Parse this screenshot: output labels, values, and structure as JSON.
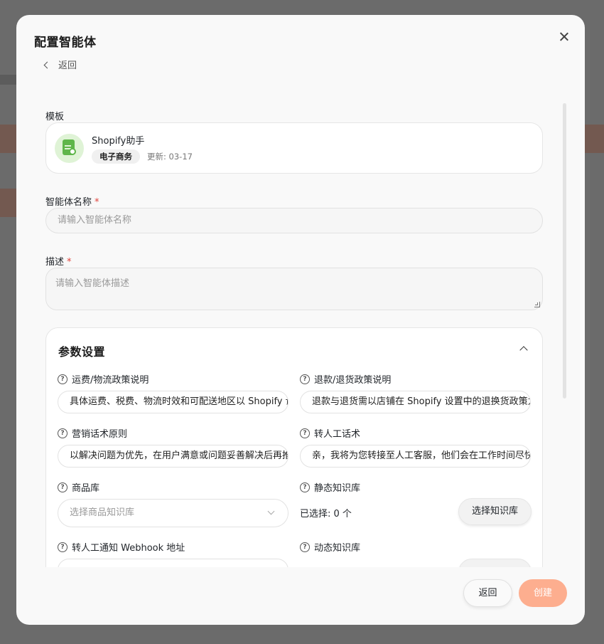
{
  "modal": {
    "title": "配置智能体",
    "back_link": "返回"
  },
  "template": {
    "label": "模板",
    "name": "Shopify助手",
    "tag": "电子商务",
    "updated": "更新: 03-17",
    "icon": "document-icon"
  },
  "agent_name": {
    "label": "智能体名称",
    "required_mark": "*",
    "placeholder": "请输入智能体名称"
  },
  "description": {
    "label": "描述",
    "required_mark": "*",
    "placeholder": "请输入智能体描述"
  },
  "params": {
    "title": "参数设置",
    "shipping_policy": {
      "label": "运费/物流政策说明",
      "value": "具体运费、税费、物流时效和可配送地区以 Shopify 设置为准"
    },
    "refund_policy": {
      "label": "退款/退货政策说明",
      "value": "退款与退货需以店铺在 Shopify 设置中的退换货政策为准"
    },
    "marketing_principle": {
      "label": "营销话术原则",
      "value": "以解决问题为优先，在用户满意或问题妥善解决后再推荐"
    },
    "handoff_script": {
      "label": "转人工话术",
      "value": "亲，我将为您转接至人工客服，他们会在工作时间尽快回复"
    },
    "product_library": {
      "label": "商品库",
      "placeholder": "选择商品知识库"
    },
    "static_kb": {
      "label": "静态知识库",
      "selected": "已选择: 0 个",
      "button": "选择知识库"
    },
    "webhook": {
      "label": "转人工通知 Webhook 地址"
    },
    "dynamic_kb": {
      "label": "动态知识库"
    }
  },
  "footer": {
    "back": "返回",
    "create": "创建"
  },
  "colors": {
    "accent_disabled": "#fdae8f",
    "required": "#e0433b",
    "template_icon_bg": "#dff3d6",
    "template_icon": "#5fb64a"
  }
}
